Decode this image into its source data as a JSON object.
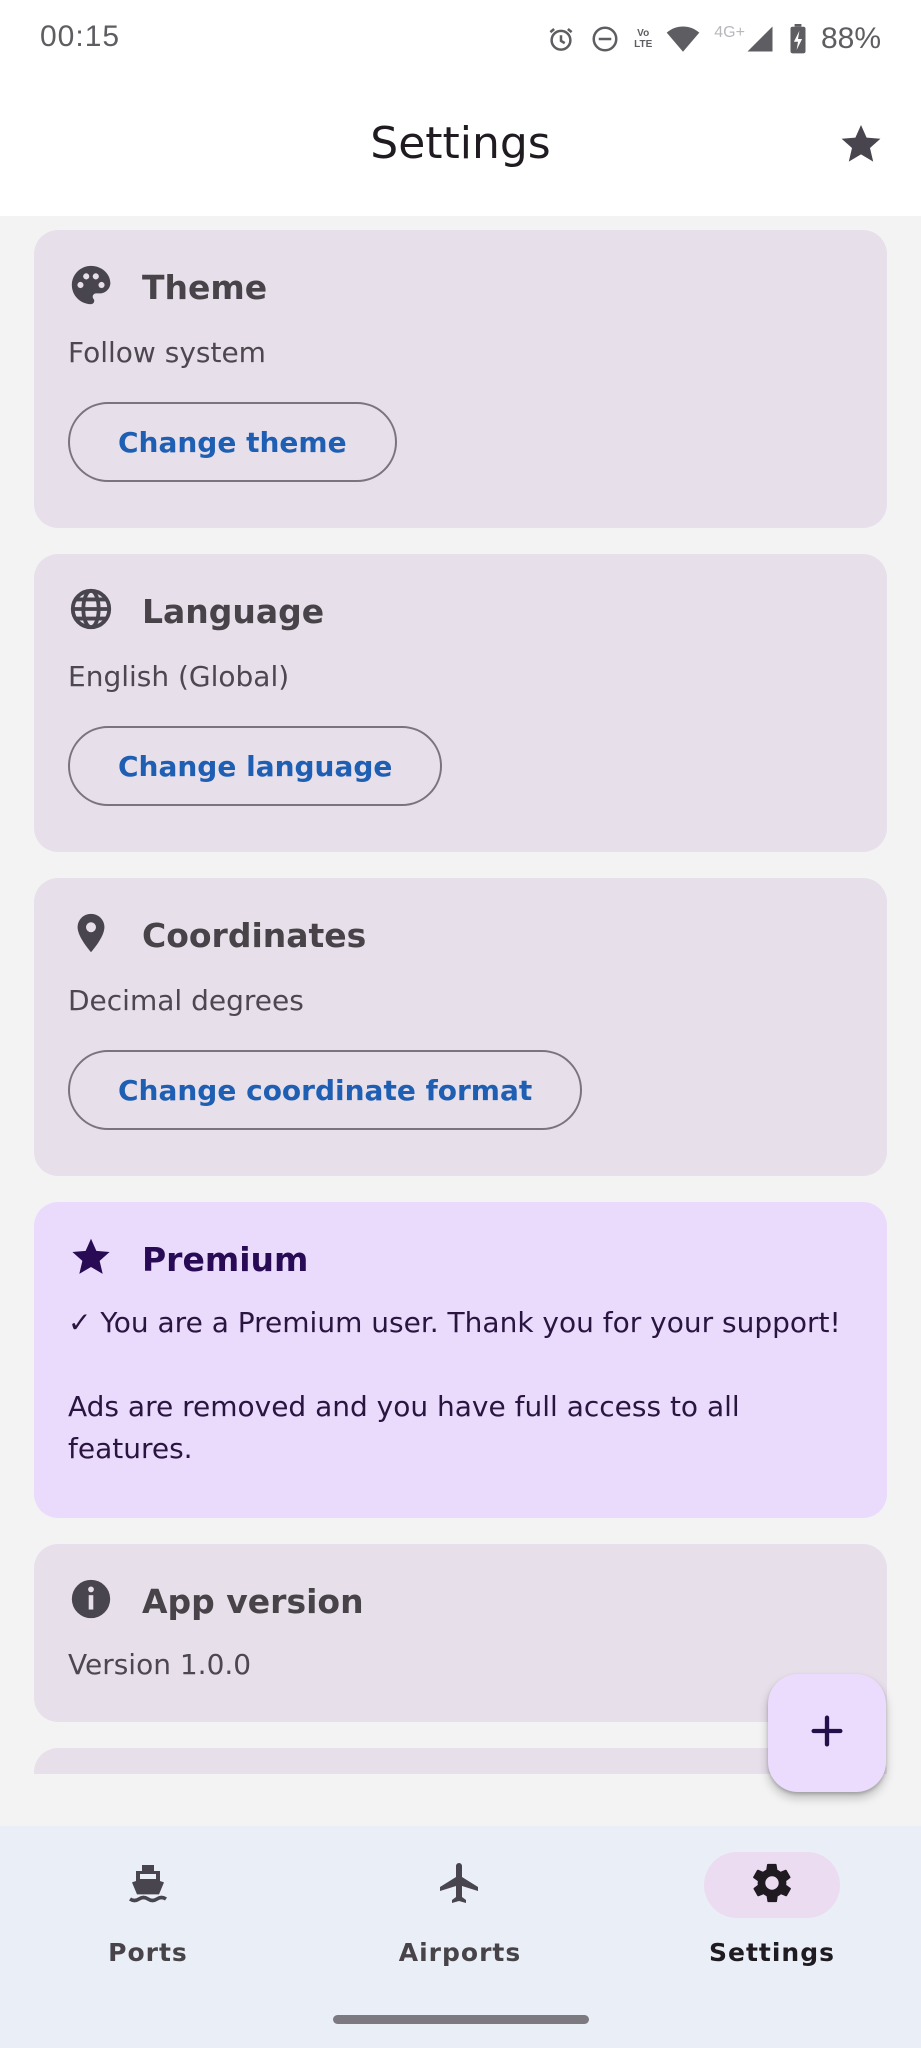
{
  "status_bar": {
    "time": "00:15",
    "network_label_top": "Vo",
    "network_label_bottom": "LTE",
    "network_type": "4G+",
    "battery": "88%",
    "icons": [
      "alarm-icon",
      "do-not-disturb-icon",
      "volte-icon",
      "wifi-icon",
      "signal-icon",
      "battery-charging-icon"
    ]
  },
  "header": {
    "title": "Settings",
    "action_icon": "star-icon"
  },
  "cards": {
    "theme": {
      "title": "Theme",
      "value": "Follow system",
      "button": "Change theme",
      "icon": "palette-icon"
    },
    "language": {
      "title": "Language",
      "value": "English (Global)",
      "button": "Change language",
      "icon": "globe-icon"
    },
    "coordinates": {
      "title": "Coordinates",
      "value": "Decimal degrees",
      "button": "Change coordinate format",
      "icon": "location-pin-icon"
    },
    "premium": {
      "title": "Premium",
      "message": "✓ You are a Premium user. Thank you for your support!",
      "details": "Ads are removed and you have full access to all features.",
      "icon": "star-icon"
    },
    "version": {
      "title": "App version",
      "value": "Version 1.0.0",
      "icon": "info-icon"
    }
  },
  "fab": {
    "icon": "plus-icon"
  },
  "bottom_nav": {
    "items": [
      {
        "label": "Ports",
        "icon": "ship-icon",
        "active": false
      },
      {
        "label": "Airports",
        "icon": "airplane-icon",
        "active": false
      },
      {
        "label": "Settings",
        "icon": "gear-icon",
        "active": true
      }
    ]
  },
  "colors": {
    "card": "#e7dfea",
    "premium_card": "#eadbfc",
    "link": "#1e5fb4",
    "nav_background": "#e9eef7",
    "active_indicator": "#ecdcf2"
  }
}
